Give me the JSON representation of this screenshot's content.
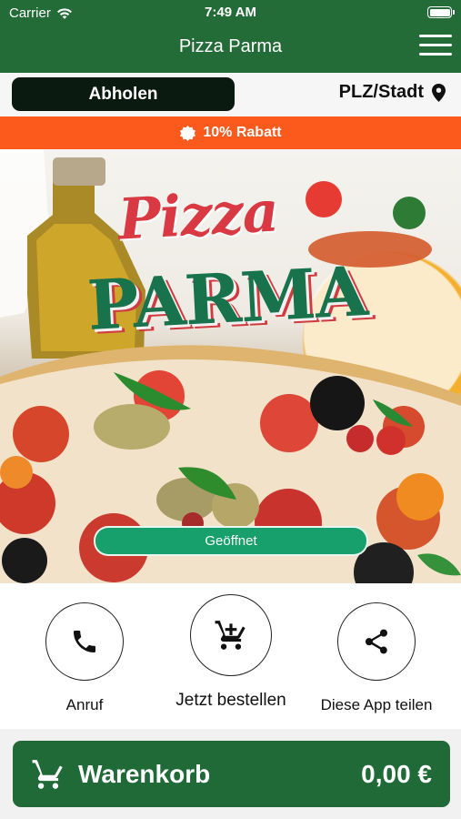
{
  "status": {
    "carrier": "Carrier",
    "time": "7:49 AM"
  },
  "header": {
    "title": "Pizza Parma"
  },
  "mode": {
    "pickup_label": "Abholen",
    "location_label": "PLZ/Stadt"
  },
  "banner": {
    "discount": "10% Rabatt"
  },
  "hero": {
    "logo_line1": "Pizza",
    "logo_line2": "PARMA",
    "status": "Geöffnet"
  },
  "actions": {
    "call": "Anruf",
    "order": "Jetzt bestellen",
    "share": "Diese App teilen"
  },
  "cart": {
    "label": "Warenkorb",
    "total": "0,00 €"
  },
  "colors": {
    "brand_green": "#236c38",
    "pickup_button": "#0b1a10",
    "discount_orange": "#fb5a1c",
    "open_green": "#17a06b"
  },
  "icons": {
    "wifi": "wifi-icon",
    "menu": "menu-icon",
    "location": "location-pin-icon",
    "discount": "discount-badge-icon",
    "call": "phone-icon",
    "order": "cart-icon",
    "share": "share-icon",
    "cart": "cart-icon"
  }
}
